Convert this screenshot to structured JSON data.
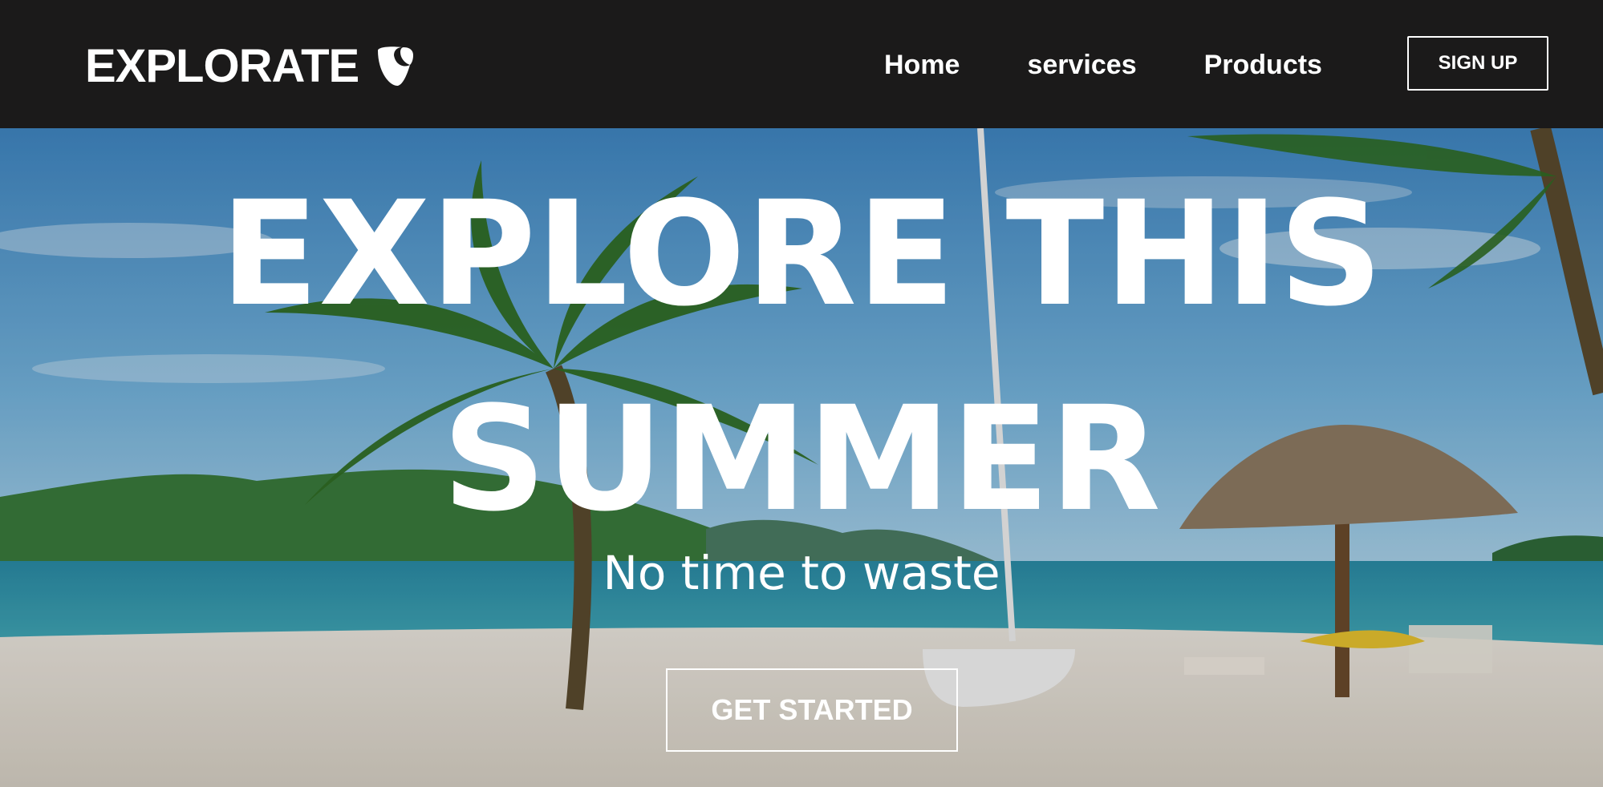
{
  "brand": {
    "name": "EXPLORATE",
    "logo_icon": "typo3-shield-icon"
  },
  "nav": {
    "links": [
      "Home",
      "services",
      "Products"
    ],
    "signup_label": "SIGN UP"
  },
  "hero": {
    "title_line1": "EXPLORE THIS",
    "title_line2": "SUMMER",
    "subtitle": "No time to waste",
    "cta_label": "GET STARTED",
    "background": "beach-palm-umbrella-photo"
  },
  "colors": {
    "navbar_bg": "#1b1a1a",
    "text": "#ffffff",
    "sky": "#5d9bc9",
    "sea": "#2f8fa5",
    "sand": "#e9e4dc"
  }
}
